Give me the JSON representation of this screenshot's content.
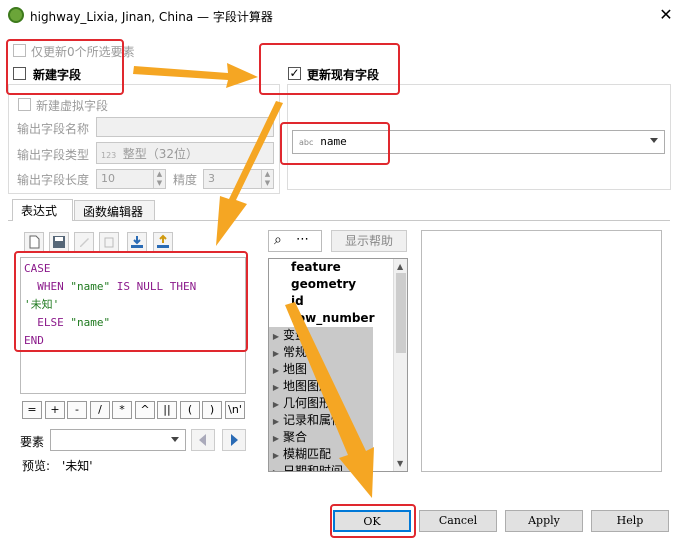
{
  "window": {
    "title": "highway_Lixia, Jinan, China — 字段计算器",
    "close_glyph": "✕"
  },
  "options": {
    "only_selected": "仅更新0个所选要素",
    "new_field": "新建字段",
    "update_existing": "更新现有字段",
    "virtual_field": "新建虚拟字段",
    "output_name_label": "输出字段名称",
    "output_type_label": "输出字段类型",
    "output_type_prefix": "123",
    "output_type_value": "整型（32位）",
    "output_length_label": "输出字段长度",
    "output_length_value": "10",
    "precision_label": "精度",
    "precision_value": "3",
    "existing_field_prefix": "abc",
    "existing_field_value": "name"
  },
  "tabs": [
    {
      "label": "表达式"
    },
    {
      "label": "函数编辑器"
    }
  ],
  "expression": {
    "lines": [
      "CASE",
      "  WHEN ",
      "\"name\"",
      " IS NULL THEN",
      "'未知'",
      "  ELSE ",
      "\"name\"",
      "END"
    ]
  },
  "operators": [
    "=",
    "+",
    "-",
    "/",
    "*",
    "^",
    "||",
    "(",
    ")",
    "\\n'"
  ],
  "feature": {
    "label": "要素",
    "preview_label": "预览:",
    "preview_value": "'未知'"
  },
  "function_panel": {
    "search_icon_glyph": "⌕",
    "more_glyph": "⋯",
    "show_help": "显示帮助",
    "items": [
      {
        "label": "feature",
        "bold": true,
        "group": false
      },
      {
        "label": "geometry",
        "bold": true,
        "group": false
      },
      {
        "label": "id",
        "bold": true,
        "group": false
      },
      {
        "label": "row_number",
        "bold": true,
        "group": false
      },
      {
        "label": "变量",
        "group": true
      },
      {
        "label": "常规",
        "group": true
      },
      {
        "label": "地图",
        "group": true
      },
      {
        "label": "地图图层",
        "group": true
      },
      {
        "label": "几何图形",
        "group": true
      },
      {
        "label": "记录和属性",
        "group": true
      },
      {
        "label": "聚合",
        "group": true
      },
      {
        "label": "模糊匹配",
        "group": true
      },
      {
        "label": "日期和时间",
        "group": true
      }
    ]
  },
  "buttons": {
    "ok": "OK",
    "cancel": "Cancel",
    "apply": "Apply",
    "help": "Help"
  },
  "colors": {
    "highlight_red": "#e0282e",
    "arrow_orange": "#f5a623",
    "keyword_purple": "#8b1a8b",
    "string_green": "#1f7a1f"
  }
}
